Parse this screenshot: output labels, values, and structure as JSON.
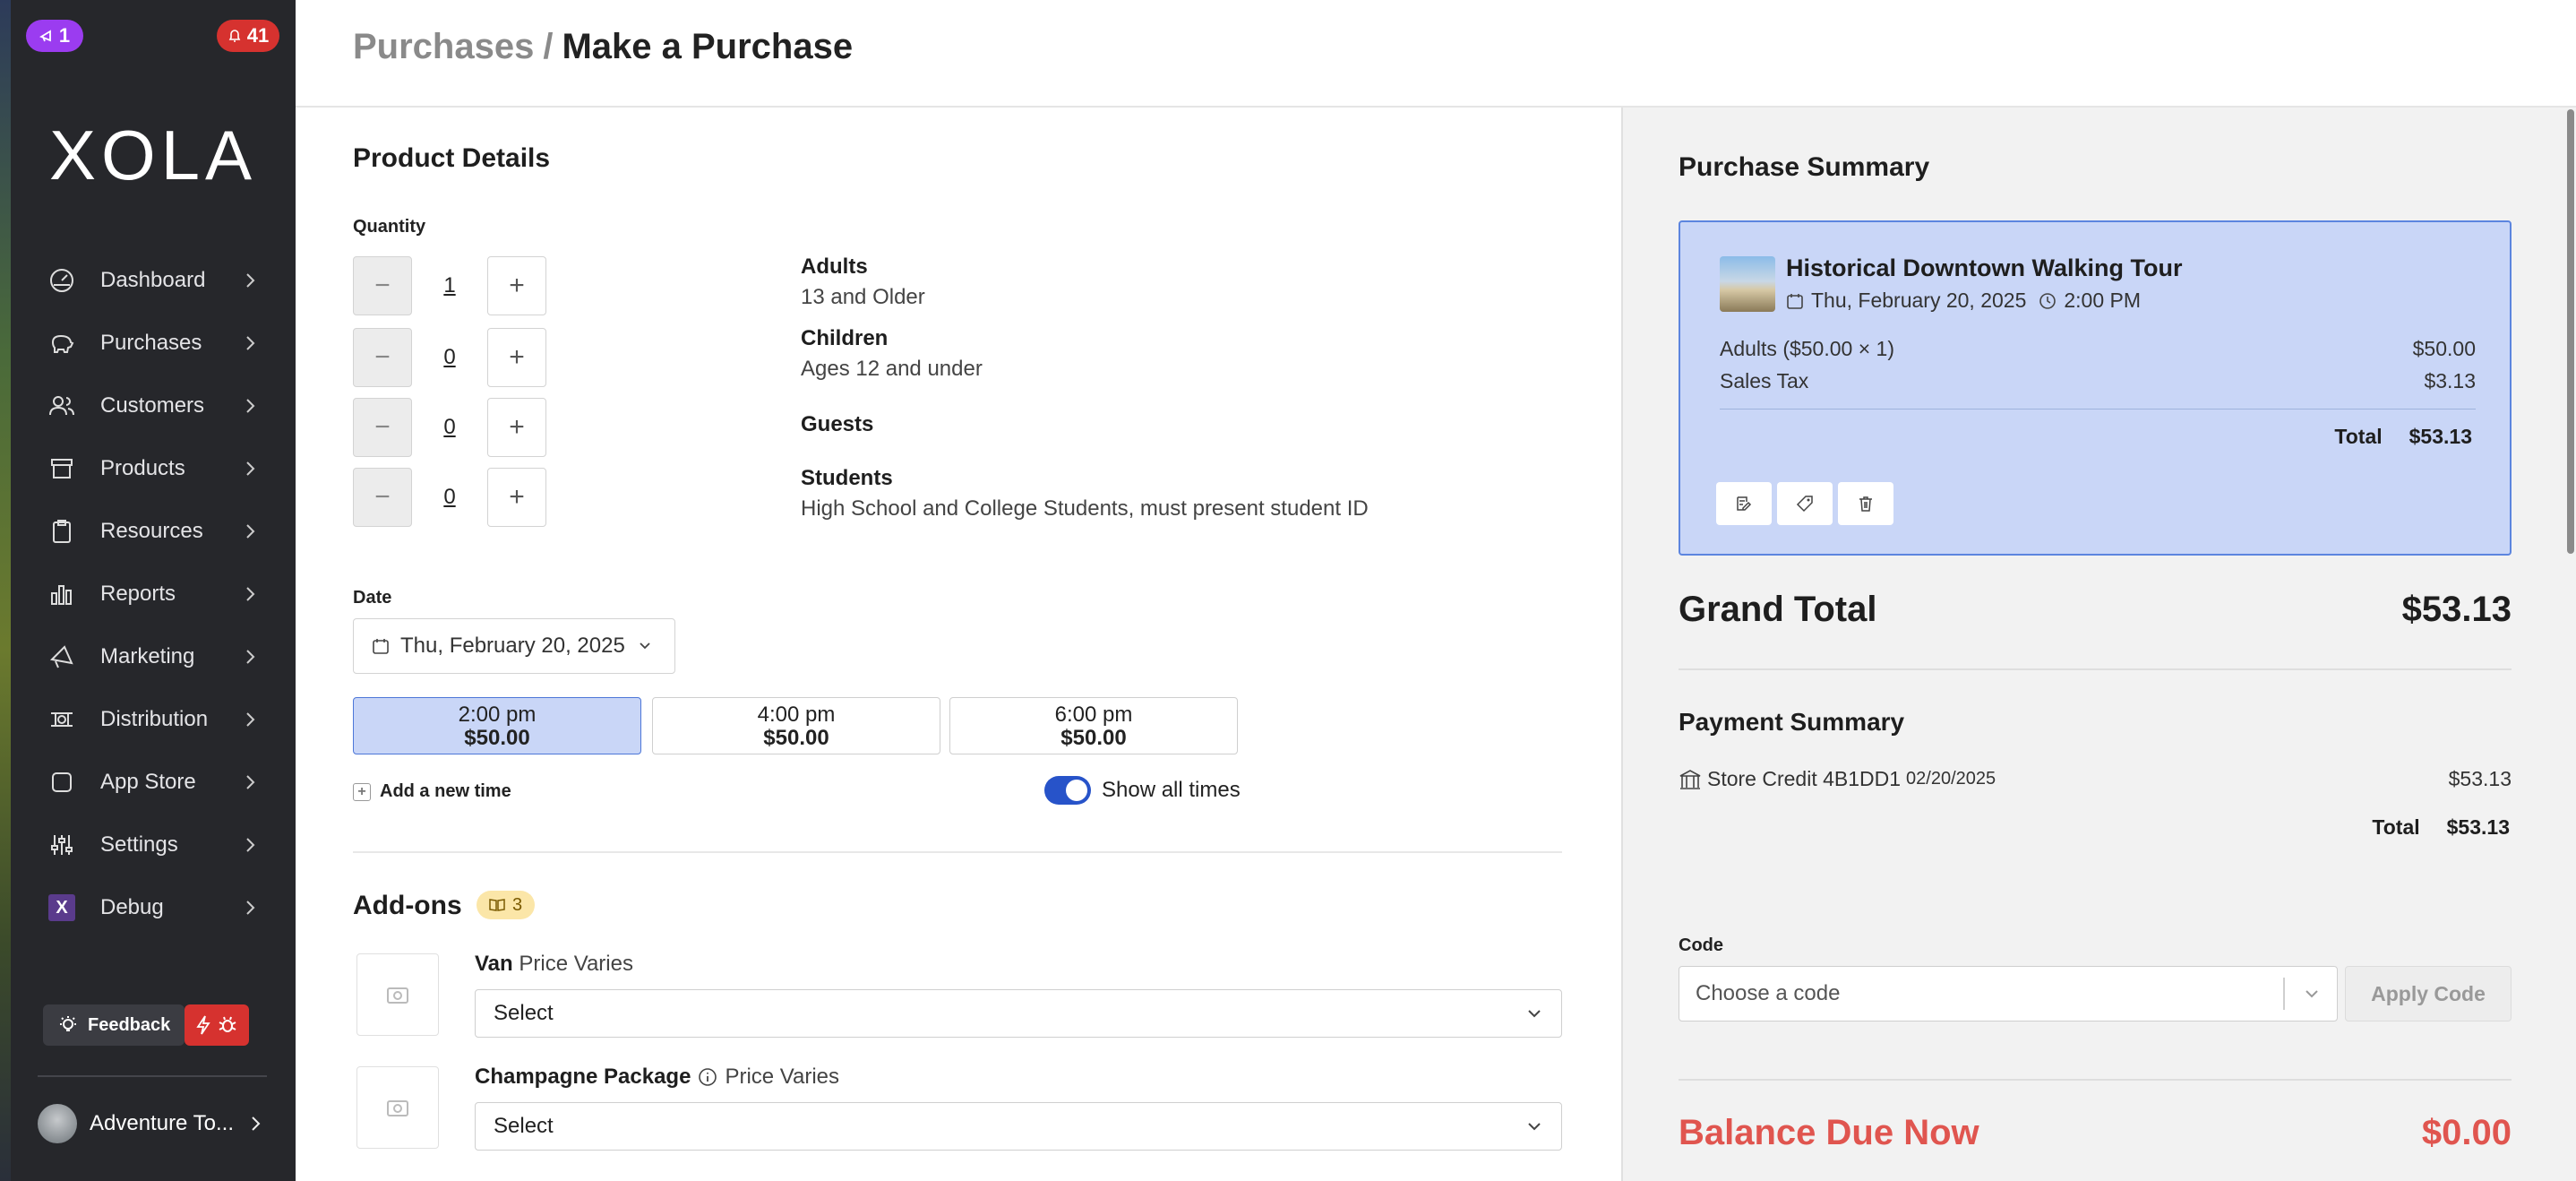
{
  "sidebar": {
    "badge_announcements": "1",
    "badge_notifications": "41",
    "logo": "XOLA",
    "items": [
      {
        "label": "Dashboard",
        "icon": "dashboard-icon"
      },
      {
        "label": "Purchases",
        "icon": "piggy-bank-icon"
      },
      {
        "label": "Customers",
        "icon": "users-icon"
      },
      {
        "label": "Products",
        "icon": "box-icon"
      },
      {
        "label": "Resources",
        "icon": "clipboard-icon"
      },
      {
        "label": "Reports",
        "icon": "bar-chart-icon"
      },
      {
        "label": "Marketing",
        "icon": "megaphone-icon"
      },
      {
        "label": "Distribution",
        "icon": "network-icon"
      },
      {
        "label": "App Store",
        "icon": "square-icon"
      },
      {
        "label": "Settings",
        "icon": "sliders-icon"
      },
      {
        "label": "Debug",
        "icon": "x-icon"
      }
    ],
    "feedback_label": "Feedback",
    "account_name": "Adventure To..."
  },
  "header": {
    "crumb_parent": "Purchases",
    "crumb_sep": "/",
    "crumb_current": "Make a Purchase"
  },
  "product": {
    "title": "Product Details",
    "quantity_label": "Quantity",
    "rows": [
      {
        "qty": "1",
        "name": "Adults",
        "desc": "13 and Older"
      },
      {
        "qty": "0",
        "name": "Children",
        "desc": "Ages 12 and under"
      },
      {
        "qty": "0",
        "name": "Guests",
        "desc": ""
      },
      {
        "qty": "0",
        "name": "Students",
        "desc": "High School and College Students, must present student ID"
      }
    ],
    "date_label": "Date",
    "date_value": "Thu, February 20, 2025",
    "slots": [
      {
        "time": "2:00 pm",
        "price": "$50.00",
        "selected": true
      },
      {
        "time": "4:00 pm",
        "price": "$50.00",
        "selected": false
      },
      {
        "time": "6:00 pm",
        "price": "$50.00",
        "selected": false
      }
    ],
    "add_time": "Add a new time",
    "show_all_times": "Show all times"
  },
  "addons": {
    "title": "Add-ons",
    "count": "3",
    "items": [
      {
        "name": "Van",
        "note": "Price Varies",
        "select": "Select"
      },
      {
        "name": "Champagne Package",
        "note": "Price Varies",
        "select": "Select"
      }
    ]
  },
  "summary": {
    "title": "Purchase Summary",
    "tour_title": "Historical Downtown Walking Tour",
    "tour_date": "Thu, February 20, 2025",
    "tour_time": "2:00 PM",
    "lines": [
      {
        "label": "Adults ($50.00 × 1)",
        "value": "$50.00"
      },
      {
        "label": "Sales Tax",
        "value": "$3.13"
      }
    ],
    "total_label": "Total",
    "total_value": "$53.13",
    "grand_label": "Grand Total",
    "grand_value": "$53.13"
  },
  "payment": {
    "title": "Payment Summary",
    "method": "Store Credit 4B1DD1",
    "method_date": "02/20/2025",
    "amount": "$53.13",
    "total_label": "Total",
    "total_value": "$53.13",
    "code_label": "Code",
    "code_placeholder": "Choose a code",
    "apply_label": "Apply Code",
    "balance_label": "Balance Due Now",
    "balance_value": "$0.00"
  }
}
